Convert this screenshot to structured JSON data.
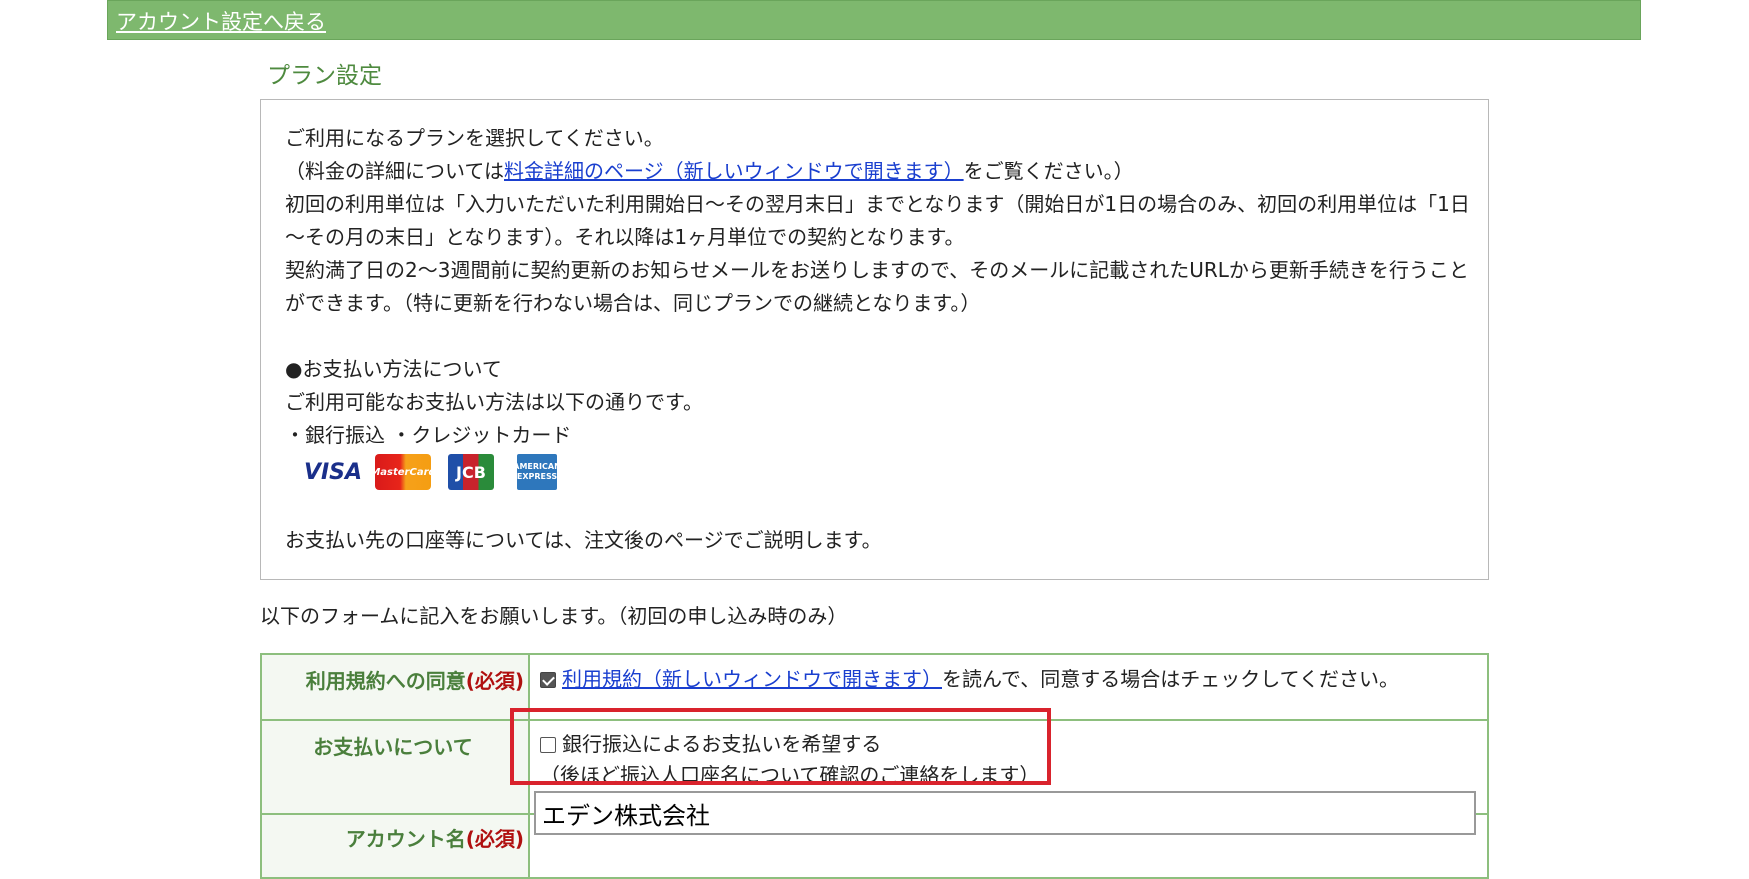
{
  "header": {
    "back_link": "アカウント設定へ戻る"
  },
  "plan": {
    "title": "プラン設定",
    "intro_line1": "ご利用になるプランを選択してください。",
    "intro_line2_prefix": "（料金の詳細については",
    "price_link": "料金詳細のページ（新しいウィンドウで開きます）",
    "intro_line2_suffix": "をご覧ください。）",
    "intro_line3": "初回の利用単位は「入力いただいた利用開始日～その翌月末日」までとなります（開始日が1日の場合のみ、初回の利用単位は「1日～その月の末日」となります）。それ以降は1ヶ月単位での契約となります。",
    "intro_line4": "契約満了日の2～3週間前に契約更新のお知らせメールをお送りしますので、そのメールに記載されたURLから更新手続きを行うことができます。（特に更新を行わない場合は、同じプランでの継続となります。）",
    "payment_heading": "●お支払い方法について",
    "payment_desc": "ご利用可能なお支払い方法は以下の通りです。",
    "payment_methods": "・銀行振込 ・クレジットカード",
    "cards": {
      "visa": "VISA",
      "mastercard": "MasterCard",
      "jcb": "JCB",
      "amex": "AMERICAN EXPRESS"
    },
    "payment_destination": "お支払い先の口座等については、注文後のページでご説明します。"
  },
  "form": {
    "note": "以下のフォームに記入をお願いします。（初回の申し込み時のみ）",
    "required_mark": "(必須)",
    "terms": {
      "label": "利用規約への同意",
      "link": "利用規約（新しいウィンドウで開きます）",
      "suffix": "を読んで、同意する場合はチェックしてください。",
      "checked": true
    },
    "payment": {
      "label": "お支払いについて",
      "option": "銀行振込によるお支払いを希望する",
      "note": "（後ほど振込人口座名について確認のご連絡をします）",
      "checked": false
    },
    "account": {
      "label": "アカウント名",
      "value": "エデン株式会社"
    }
  },
  "colors": {
    "header_bg": "#7eb86e",
    "highlight": "#d9232d",
    "link": "#1a3fcf"
  }
}
